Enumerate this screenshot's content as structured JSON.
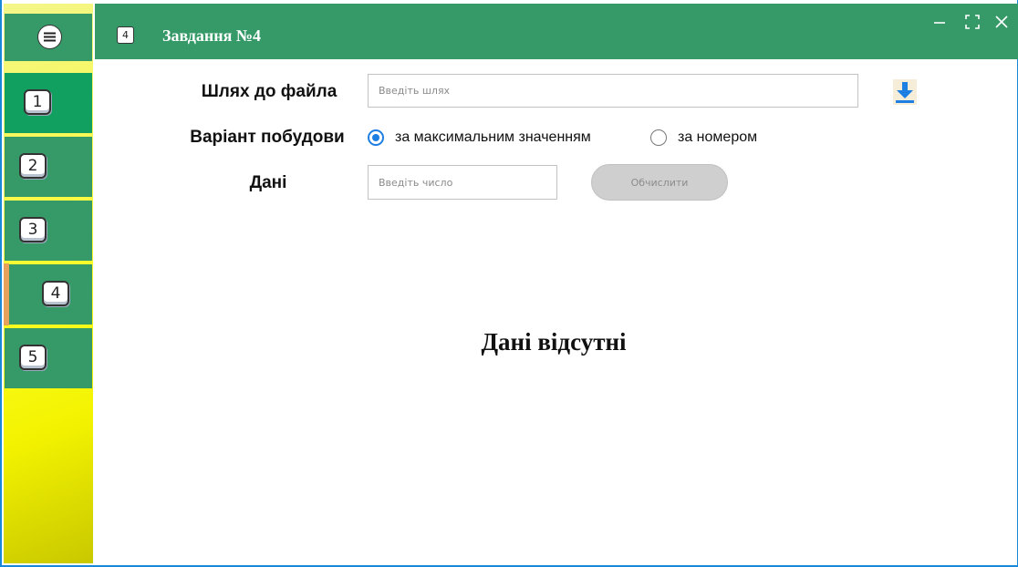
{
  "titlebar": {
    "icon_number": "4",
    "title": "Завдання №4"
  },
  "sidebar": {
    "menu_icon": "menu-icon",
    "items": [
      {
        "label": "1"
      },
      {
        "label": "2"
      },
      {
        "label": "3"
      },
      {
        "label": "4"
      },
      {
        "label": "5"
      }
    ],
    "active_index": 3
  },
  "form": {
    "file_path_label": "Шлях до файла",
    "file_path_placeholder": "Введіть шлях",
    "file_path_value": "",
    "build_variant_label": "Варіант побудови",
    "radio_options": [
      {
        "label": "за максимальним значенням",
        "checked": true
      },
      {
        "label": "за номером",
        "checked": false
      }
    ],
    "data_label": "Дані",
    "data_placeholder": "Введіть число",
    "data_value": "",
    "calculate_label": "Обчислити",
    "download_icon": "download-icon"
  },
  "main": {
    "no_data_text": "Дані відсутні"
  },
  "colors": {
    "accent_green": "#369a68",
    "active_green": "#11a060",
    "radio_blue": "#1e7fe3",
    "indicator_orange": "#e6a25a"
  }
}
